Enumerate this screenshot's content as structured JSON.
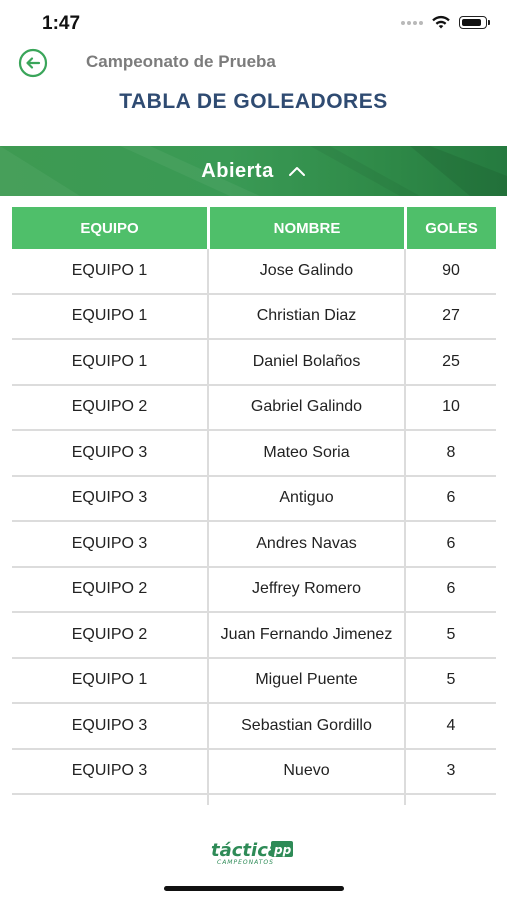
{
  "status_bar": {
    "time": "1:47",
    "battery_level": 0.85
  },
  "header": {
    "title": "Campeonato de Prueba",
    "back_icon": "arrow-left-circle-icon"
  },
  "page_title": "TABLA DE GOLEADORES",
  "category": {
    "label": "Abierta",
    "toggle_icon": "chevron-up-icon"
  },
  "table": {
    "columns": [
      "EQUIPO",
      "NOMBRE",
      "GOLES"
    ],
    "rows": [
      {
        "team": "EQUIPO 1",
        "name": "Jose Galindo",
        "goals": "90"
      },
      {
        "team": "EQUIPO 1",
        "name": "Christian Diaz",
        "goals": "27"
      },
      {
        "team": "EQUIPO 1",
        "name": "Daniel Bolaños",
        "goals": "25"
      },
      {
        "team": "EQUIPO 2",
        "name": "Gabriel Galindo",
        "goals": "10"
      },
      {
        "team": "EQUIPO 3",
        "name": "Mateo Soria",
        "goals": "8"
      },
      {
        "team": "EQUIPO 3",
        "name": "Antiguo",
        "goals": "6"
      },
      {
        "team": "EQUIPO 3",
        "name": "Andres Navas",
        "goals": "6"
      },
      {
        "team": "EQUIPO 2",
        "name": "Jeffrey Romero",
        "goals": "6"
      },
      {
        "team": "EQUIPO 2",
        "name": "Juan Fernando Jimenez",
        "goals": "5"
      },
      {
        "team": "EQUIPO 1",
        "name": "Miguel Puente",
        "goals": "5"
      },
      {
        "team": "EQUIPO 3",
        "name": "Sebastian Gordillo",
        "goals": "4"
      },
      {
        "team": "EQUIPO 3",
        "name": "Nuevo",
        "goals": "3"
      }
    ]
  },
  "footer": {
    "logo_text": "táctica",
    "logo_subtext": "CAMPEONATOS"
  },
  "colors": {
    "accent_green": "#4fbf6a",
    "banner_green": "#3a9a55",
    "title_blue": "#2f4b72",
    "back_green": "#3aa55a"
  }
}
